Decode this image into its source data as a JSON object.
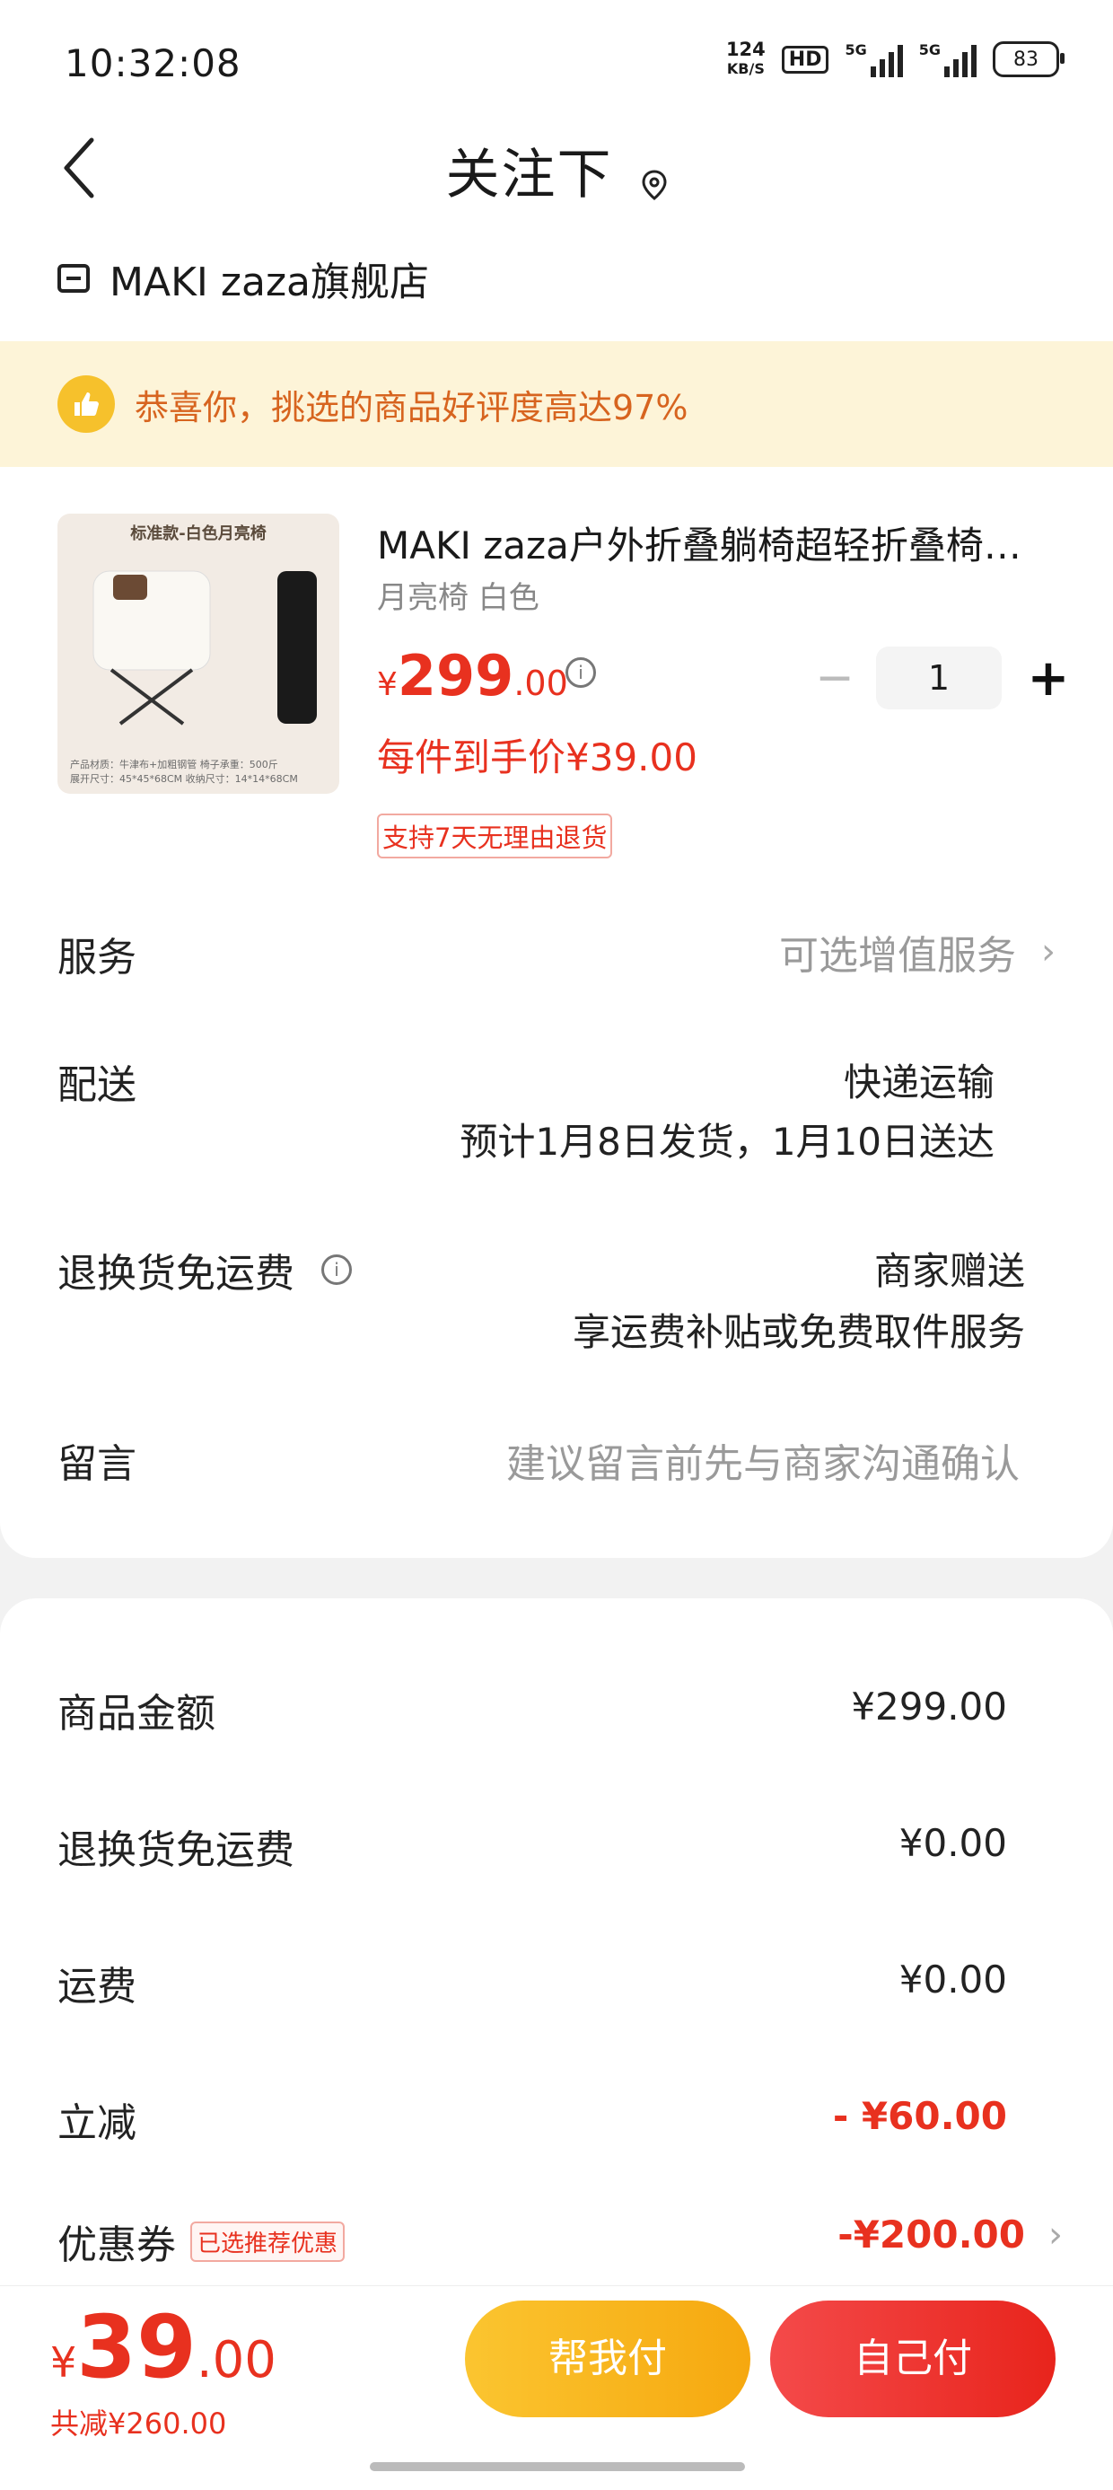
{
  "status_bar": {
    "time": "10:32:08",
    "speed": "124",
    "speed_unit": "KB/S",
    "hd": "HD",
    "net1": "5G",
    "net2": "5G",
    "battery": "83"
  },
  "nav": {
    "title": "关注下"
  },
  "store": {
    "name": "MAKI zaza旗舰店"
  },
  "banner": {
    "text": "恭喜你，挑选的商品好评度高达97%"
  },
  "product": {
    "image_title": "标准款-白色月亮椅",
    "image_spec_line1": "产品材质：牛津布+加粗钢管   椅子承重：500斤",
    "image_spec_line2": "展开尺寸：45*45*68CM   收纳尺寸：14*14*68CM",
    "name": "MAKI zaza户外折叠躺椅超轻折叠椅…",
    "spec": "月亮椅 白色",
    "price_symbol": "¥",
    "price_int": "299",
    "price_dec": ".00",
    "quantity": "1",
    "hand_price": "每件到手价¥39.00",
    "return_tag": "支持7天无理由退货"
  },
  "rows": {
    "service_label": "服务",
    "service_value": "可选增值服务",
    "delivery_label": "配送",
    "delivery_method": "快递运输",
    "delivery_eta": "预计1月8日发货，1月10日送达",
    "return_free_label": "退换货免运费",
    "return_free_value": "商家赠送",
    "return_free_desc": "享运费补贴或免费取件服务",
    "message_label": "留言",
    "message_placeholder": "建议留言前先与商家沟通确认"
  },
  "summary": {
    "goods_amount_label": "商品金额",
    "goods_amount": "¥299.00",
    "return_fee_label": "退换货免运费",
    "return_fee": "¥0.00",
    "shipping_label": "运费",
    "shipping": "¥0.00",
    "discount_label": "立减",
    "discount": "- ¥60.00",
    "coupon_label": "优惠券",
    "coupon_tag": "已选推荐优惠",
    "coupon": "-¥200.00"
  },
  "bottom": {
    "total_symbol": "¥",
    "total_int": "39",
    "total_dec": ".00",
    "total_reduce": "共减¥260.00",
    "help_pay": "帮我付",
    "self_pay": "自己付"
  },
  "colors": {
    "accent_red": "#e8311f",
    "accent_yellow": "#fbc530",
    "banner_bg": "#fdf4d8"
  }
}
